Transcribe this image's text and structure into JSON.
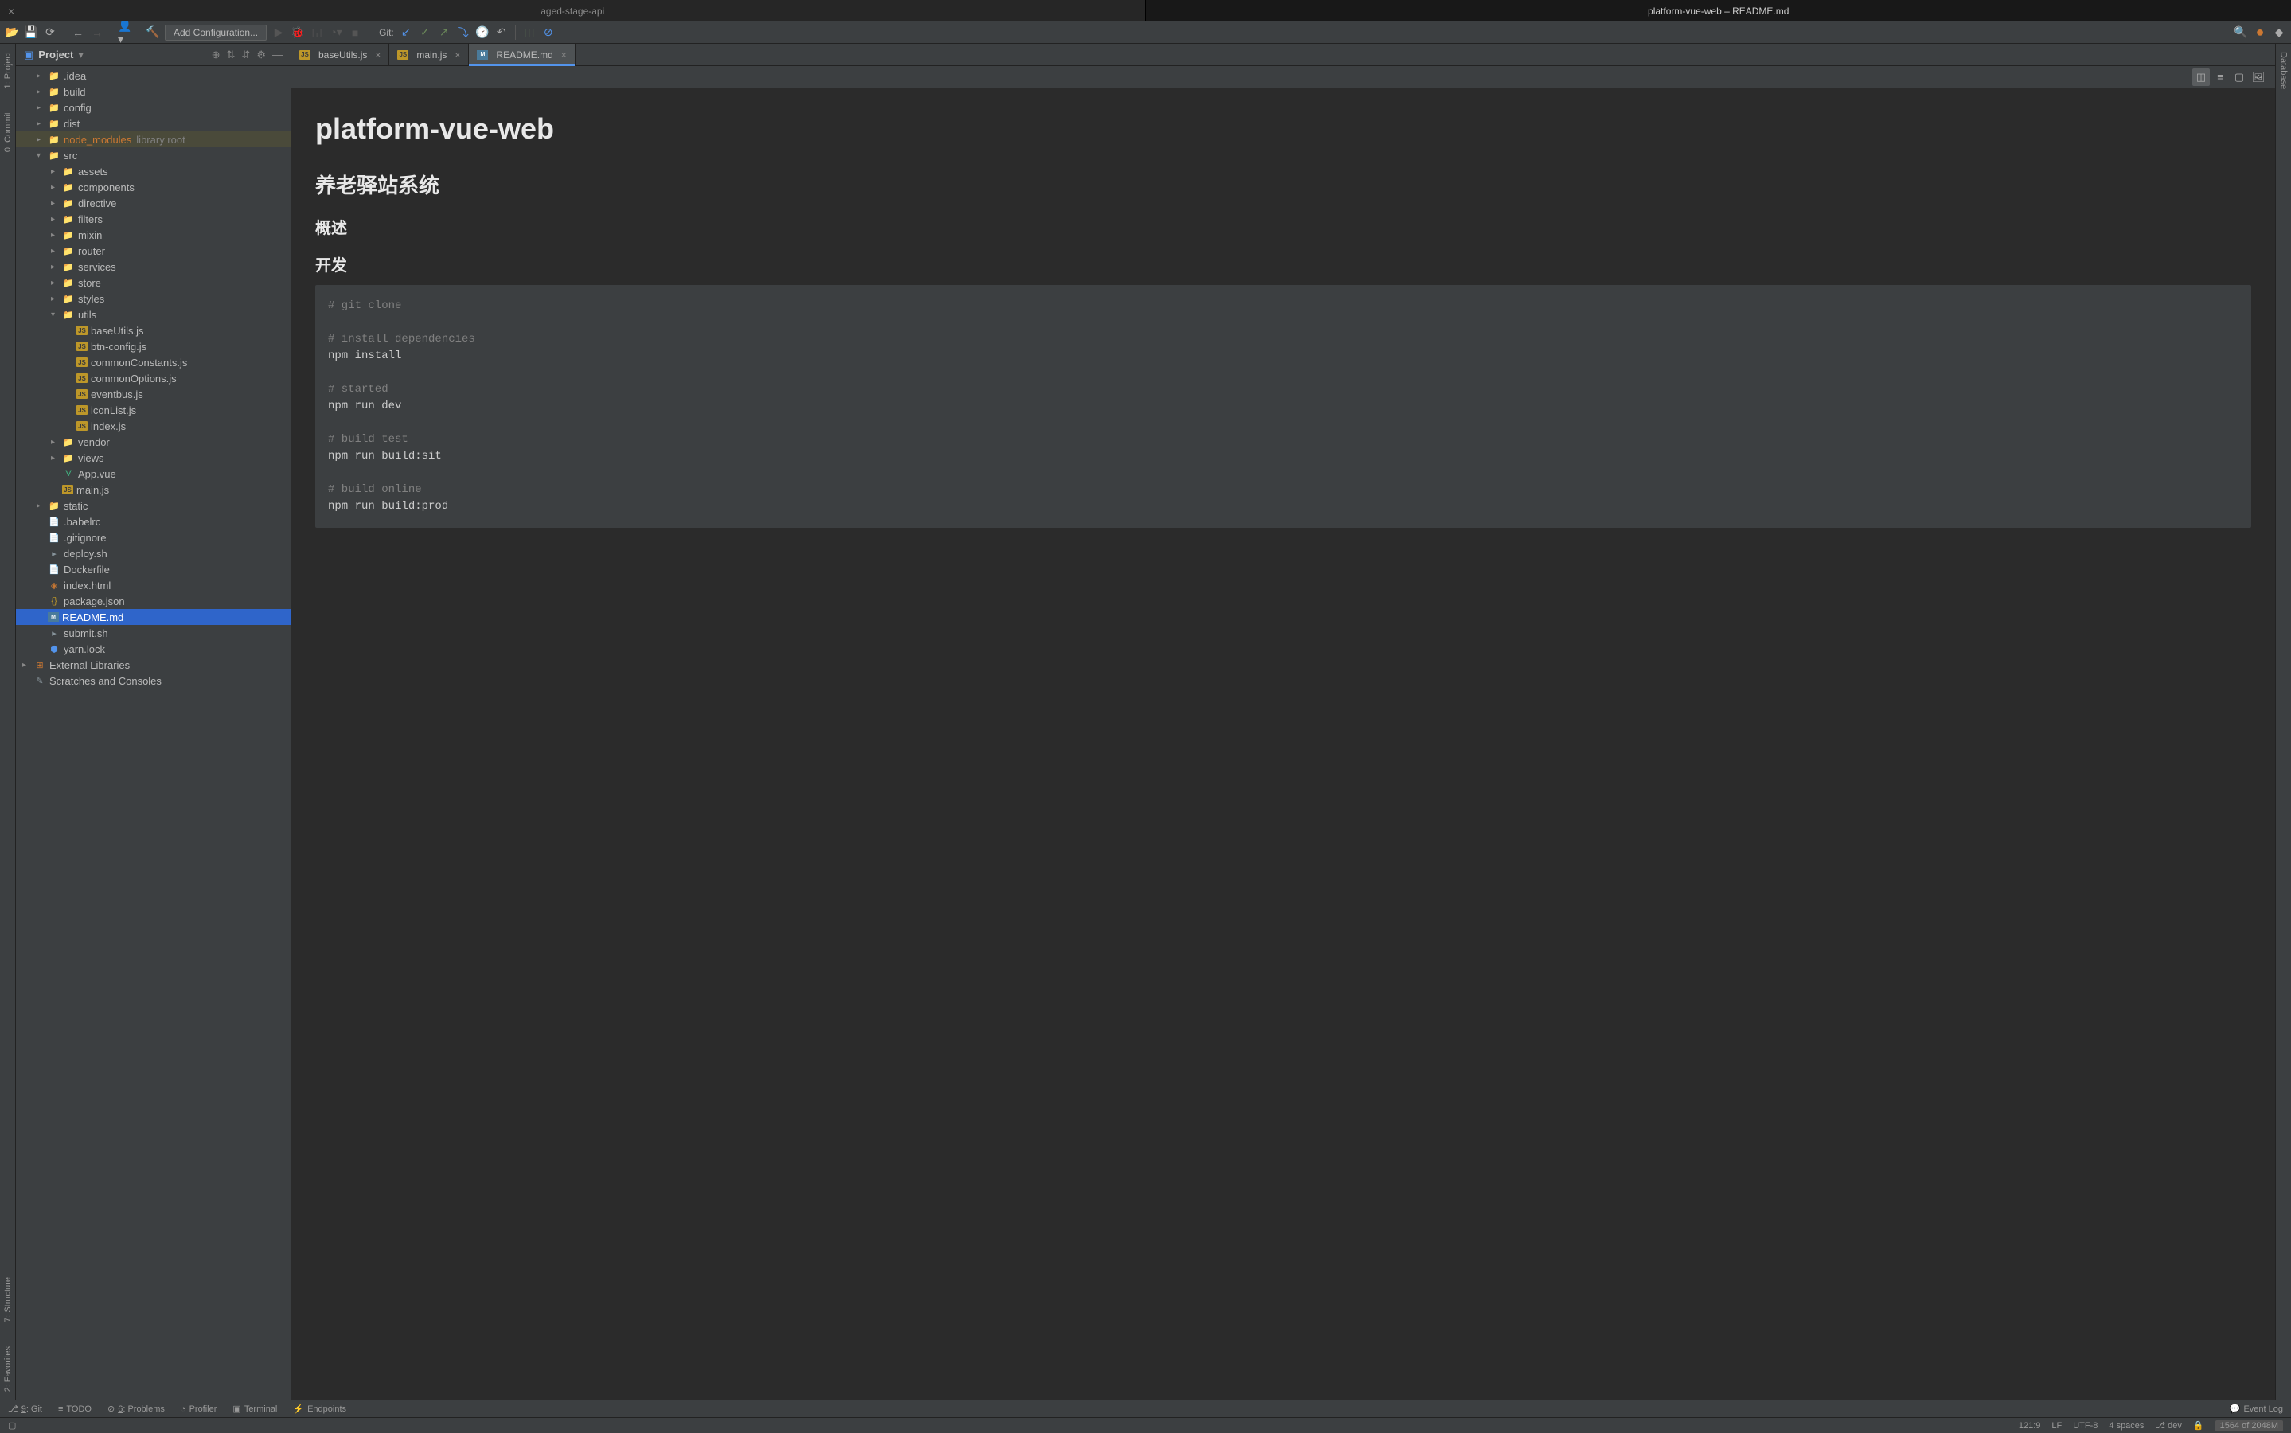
{
  "title_bar": {
    "left_tab": "aged-stage-api",
    "right_tab": "platform-vue-web – README.md"
  },
  "toolbar": {
    "config_label": "Add Configuration...",
    "git_label": "Git:"
  },
  "project_panel": {
    "title": "Project",
    "tree": [
      {
        "indent": 1,
        "arrow": ">",
        "icon": "folder",
        "label": ".idea",
        "color": "orange"
      },
      {
        "indent": 1,
        "arrow": ">",
        "icon": "folder",
        "label": "build"
      },
      {
        "indent": 1,
        "arrow": ">",
        "icon": "folder",
        "label": "config"
      },
      {
        "indent": 1,
        "arrow": ">",
        "icon": "folder",
        "label": "dist",
        "color": "orange"
      },
      {
        "indent": 1,
        "arrow": ">",
        "icon": "folder",
        "label": "node_modules",
        "color": "orange",
        "sublabel": "library root",
        "highlighted": true
      },
      {
        "indent": 1,
        "arrow": "v",
        "icon": "folder",
        "label": "src"
      },
      {
        "indent": 2,
        "arrow": ">",
        "icon": "folder",
        "label": "assets"
      },
      {
        "indent": 2,
        "arrow": ">",
        "icon": "folder",
        "label": "components"
      },
      {
        "indent": 2,
        "arrow": ">",
        "icon": "folder",
        "label": "directive"
      },
      {
        "indent": 2,
        "arrow": ">",
        "icon": "folder",
        "label": "filters"
      },
      {
        "indent": 2,
        "arrow": ">",
        "icon": "folder",
        "label": "mixin"
      },
      {
        "indent": 2,
        "arrow": ">",
        "icon": "folder",
        "label": "router"
      },
      {
        "indent": 2,
        "arrow": ">",
        "icon": "folder",
        "label": "services"
      },
      {
        "indent": 2,
        "arrow": ">",
        "icon": "folder",
        "label": "store"
      },
      {
        "indent": 2,
        "arrow": ">",
        "icon": "folder",
        "label": "styles"
      },
      {
        "indent": 2,
        "arrow": "v",
        "icon": "folder",
        "label": "utils"
      },
      {
        "indent": 3,
        "arrow": "",
        "icon": "js",
        "label": "baseUtils.js"
      },
      {
        "indent": 3,
        "arrow": "",
        "icon": "js",
        "label": "btn-config.js"
      },
      {
        "indent": 3,
        "arrow": "",
        "icon": "js",
        "label": "commonConstants.js"
      },
      {
        "indent": 3,
        "arrow": "",
        "icon": "js",
        "label": "commonOptions.js"
      },
      {
        "indent": 3,
        "arrow": "",
        "icon": "js",
        "label": "eventbus.js"
      },
      {
        "indent": 3,
        "arrow": "",
        "icon": "js",
        "label": "iconList.js"
      },
      {
        "indent": 3,
        "arrow": "",
        "icon": "js",
        "label": "index.js"
      },
      {
        "indent": 2,
        "arrow": ">",
        "icon": "folder",
        "label": "vendor"
      },
      {
        "indent": 2,
        "arrow": ">",
        "icon": "folder",
        "label": "views"
      },
      {
        "indent": 2,
        "arrow": "",
        "icon": "vue",
        "label": "App.vue"
      },
      {
        "indent": 2,
        "arrow": "",
        "icon": "js",
        "label": "main.js"
      },
      {
        "indent": 1,
        "arrow": ">",
        "icon": "folder",
        "label": "static"
      },
      {
        "indent": 1,
        "arrow": "",
        "icon": "file",
        "label": ".babelrc"
      },
      {
        "indent": 1,
        "arrow": "",
        "icon": "file",
        "label": ".gitignore"
      },
      {
        "indent": 1,
        "arrow": "",
        "icon": "sh",
        "label": "deploy.sh"
      },
      {
        "indent": 1,
        "arrow": "",
        "icon": "file",
        "label": "Dockerfile"
      },
      {
        "indent": 1,
        "arrow": "",
        "icon": "html",
        "label": "index.html"
      },
      {
        "indent": 1,
        "arrow": "",
        "icon": "json",
        "label": "package.json"
      },
      {
        "indent": 1,
        "arrow": "",
        "icon": "md",
        "label": "README.md",
        "selected": true
      },
      {
        "indent": 1,
        "arrow": "",
        "icon": "sh",
        "label": "submit.sh"
      },
      {
        "indent": 1,
        "arrow": "",
        "icon": "yarn",
        "label": "yarn.lock"
      },
      {
        "indent": 0,
        "arrow": ">",
        "icon": "lib",
        "label": "External Libraries"
      },
      {
        "indent": 0,
        "arrow": "",
        "icon": "scratch",
        "label": "Scratches and Consoles"
      }
    ]
  },
  "editor_tabs": [
    {
      "icon": "js",
      "label": "baseUtils.js",
      "active": false
    },
    {
      "icon": "js",
      "label": "main.js",
      "active": false
    },
    {
      "icon": "md",
      "label": "README.md",
      "active": true
    }
  ],
  "preview": {
    "h1": "platform-vue-web",
    "h2": "养老驿站系统",
    "h3a": "概述",
    "h3b": "开发",
    "code_lines": [
      {
        "text": "# git clone",
        "comment": true
      },
      {
        "text": "",
        "comment": false
      },
      {
        "text": "# install dependencies",
        "comment": true
      },
      {
        "text": "npm install",
        "comment": false
      },
      {
        "text": "",
        "comment": false
      },
      {
        "text": "# started",
        "comment": true
      },
      {
        "text": "npm run dev",
        "comment": false
      },
      {
        "text": "",
        "comment": false
      },
      {
        "text": "# build test",
        "comment": true
      },
      {
        "text": "npm run build:sit",
        "comment": false
      },
      {
        "text": "",
        "comment": false
      },
      {
        "text": "# build online",
        "comment": true
      },
      {
        "text": "npm run build:prod",
        "comment": false
      }
    ]
  },
  "left_sidebar_labels": {
    "project": "1: Project",
    "commit": "0: Commit",
    "structure": "7: Structure",
    "favorites": "2: Favorites"
  },
  "right_sidebar_labels": {
    "database": "Database"
  },
  "bottom_bar": {
    "git": "9: Git",
    "todo": "TODO",
    "problems": "6: Problems",
    "profiler": "Profiler",
    "terminal": "Terminal",
    "endpoints": "Endpoints",
    "event_log": "Event Log"
  },
  "status_bar": {
    "position": "121:9",
    "line_sep": "LF",
    "encoding": "UTF-8",
    "indent": "4 spaces",
    "branch": "dev",
    "memory": "1564 of 2048M"
  }
}
